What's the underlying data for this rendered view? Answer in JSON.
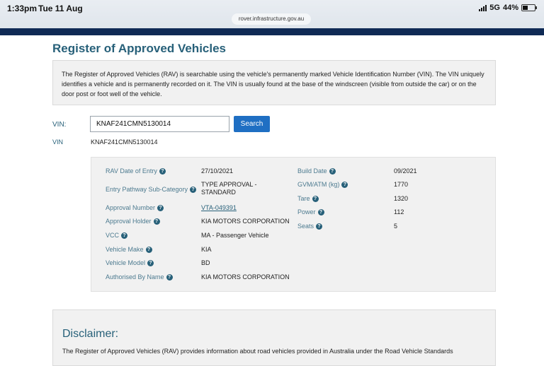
{
  "status_bar": {
    "time": "1:33pm",
    "date": "Tue 11 Aug",
    "network": "5G",
    "battery": "44%"
  },
  "browser": {
    "url": "rover.infrastructure.gov.au"
  },
  "page": {
    "title": "Register of Approved Vehicles",
    "intro": "The Register of Approved Vehicles (RAV) is searchable using the vehicle's permanently marked Vehicle Identification Number (VIN). The VIN uniquely identifies a vehicle and is permanently recorded on it. The VIN is usually found at the base of the windscreen (visible from outside the car) or on the door post or foot well of the vehicle."
  },
  "search": {
    "label": "VIN:",
    "value": "KNAF241CMN5130014",
    "button": "Search"
  },
  "result": {
    "vin_label": "VIN",
    "vin_value": "KNAF241CMN5130014"
  },
  "details": {
    "left": [
      {
        "label": "RAV Date of Entry",
        "value": "27/10/2021"
      },
      {
        "label": "Entry Pathway Sub-Category",
        "value": "TYPE APPROVAL -\nSTANDARD"
      },
      {
        "label": "Approval Number",
        "value": "VTA-049391"
      },
      {
        "label": "Approval Holder",
        "value": "KIA MOTORS CORPORATION"
      },
      {
        "label": "VCC",
        "value": "MA - Passenger Vehicle"
      },
      {
        "label": "Vehicle Make",
        "value": "KIA"
      },
      {
        "label": "Vehicle Model",
        "value": "BD"
      },
      {
        "label": "Authorised By Name",
        "value": "KIA MOTORS CORPORATION"
      }
    ],
    "right": [
      {
        "label": "Build Date",
        "value": "09/2021"
      },
      {
        "label": "GVM/ATM (kg)",
        "value": "1770"
      },
      {
        "label": "Tare",
        "value": "1320"
      },
      {
        "label": "Power",
        "value": "112"
      },
      {
        "label": "Seats",
        "value": "5"
      }
    ],
    "info_icon": "info-icon"
  },
  "disclaimer": {
    "title": "Disclaimer:",
    "text": "The Register of Approved Vehicles (RAV) provides information about road vehicles provided in Australia under the Road Vehicle Standards"
  }
}
